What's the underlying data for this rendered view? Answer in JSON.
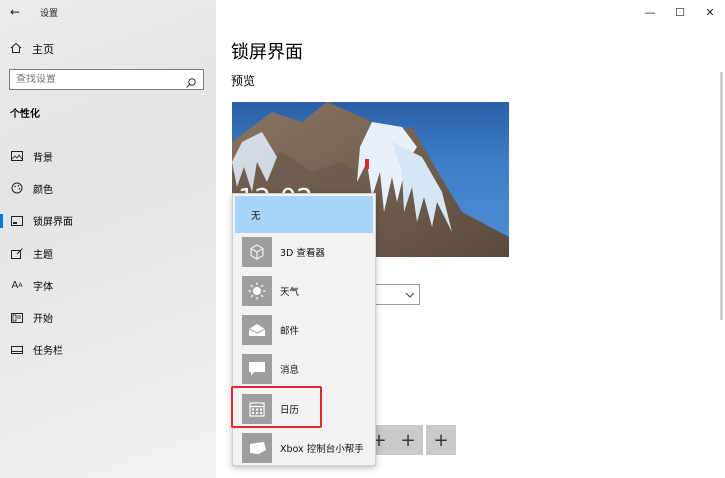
{
  "window": {
    "title": "设置",
    "controls": {
      "minimize": "—",
      "maximize": "☐",
      "close": "✕"
    }
  },
  "sidebar": {
    "home_label": "主页",
    "search_placeholder": "查找设置",
    "section_title": "个性化",
    "items": [
      {
        "label": "背景",
        "icon": "background-icon"
      },
      {
        "label": "颜色",
        "icon": "palette-icon"
      },
      {
        "label": "锁屏界面",
        "icon": "lock-screen-icon",
        "active": true
      },
      {
        "label": "主题",
        "icon": "theme-icon"
      },
      {
        "label": "字体",
        "icon": "font-icon"
      },
      {
        "label": "开始",
        "icon": "start-icon"
      },
      {
        "label": "任务栏",
        "icon": "taskbar-icon"
      }
    ]
  },
  "main": {
    "page_title": "锁屏界面",
    "preview_label": "预览",
    "preview_time": "12:02"
  },
  "dropdown": {
    "items": [
      {
        "label": "无",
        "selected": true
      },
      {
        "label": "3D 查看器",
        "icon": "3d-cube-icon"
      },
      {
        "label": "天气",
        "icon": "sun-icon"
      },
      {
        "label": "邮件",
        "icon": "mail-icon"
      },
      {
        "label": "消息",
        "icon": "message-icon"
      },
      {
        "label": "日历",
        "icon": "calendar-icon"
      },
      {
        "label": "Xbox 控制台小帮手",
        "icon": "xbox-controller-icon"
      }
    ]
  },
  "quick_status_buttons": [
    "+",
    "+",
    "+"
  ],
  "colors": {
    "accent": "#0078d7",
    "selected_bg": "#a6d4fa",
    "highlight": "#e0282e",
    "tile": "#9e9e9e"
  }
}
